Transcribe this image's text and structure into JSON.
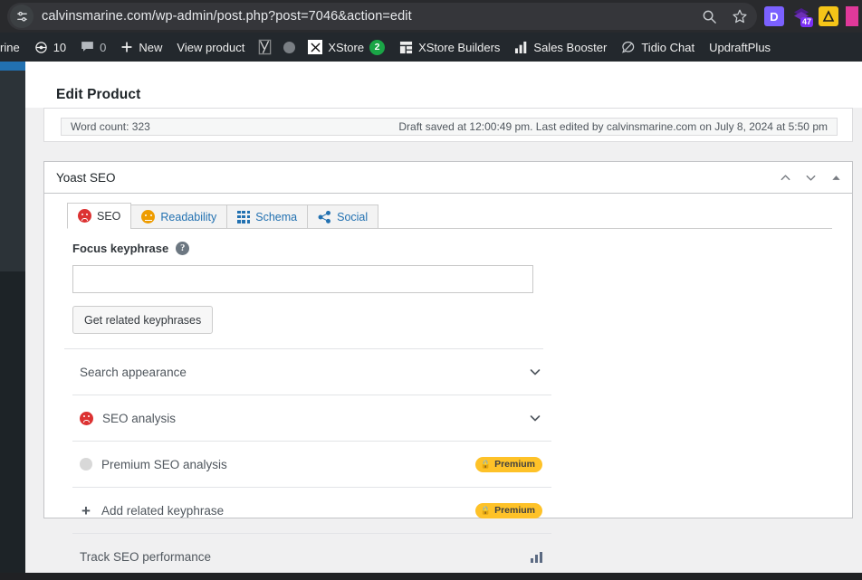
{
  "browser": {
    "site_info_icon": "tune-icon",
    "url": "calvinsmarine.com/wp-admin/post.php?post=7046&action=edit",
    "actions": [
      {
        "name": "search-icon",
        "glyph": "search"
      },
      {
        "name": "bookmark-star-icon",
        "glyph": "star"
      }
    ],
    "extensions": [
      {
        "name": "extension-icon-d",
        "label": "D",
        "bg": "#7b61ff",
        "fg": "#ffffff",
        "badge": null
      },
      {
        "name": "extension-icon-purple-stack",
        "label": "",
        "bg": "#5b2d8e",
        "fg": "#ffffff",
        "badge": "47"
      },
      {
        "name": "extension-icon-yellow-a",
        "label": "A",
        "bg": "#f5c518",
        "fg": "#1d1d1d",
        "badge": null
      },
      {
        "name": "extension-icon-pink",
        "label": "",
        "bg": "#e0399a",
        "fg": "#ffffff",
        "badge": null
      }
    ]
  },
  "adminbar": {
    "items": [
      {
        "name": "site-name",
        "label": "rine",
        "icon": null,
        "num": null,
        "count": null
      },
      {
        "name": "updates",
        "label": "",
        "icon": "updates-icon",
        "num": "10",
        "count": null
      },
      {
        "name": "comments",
        "label": "",
        "icon": "comment-icon",
        "num": "0",
        "count": null
      },
      {
        "name": "new-content",
        "label": "New",
        "icon": "plus-icon",
        "num": null,
        "count": null
      },
      {
        "name": "view-product",
        "label": "View product",
        "icon": null,
        "num": null,
        "count": null
      },
      {
        "name": "yoast-seo",
        "label": "",
        "icon": "yoast-y-icon",
        "num": null,
        "count": null
      },
      {
        "name": "notification-dot",
        "label": "",
        "icon": "grey-circle-icon",
        "num": null,
        "count": null
      },
      {
        "name": "xstore",
        "label": "XStore",
        "icon": "xstore-icon",
        "num": null,
        "count": "2"
      },
      {
        "name": "xstore-builders",
        "label": "XStore Builders",
        "icon": "builders-grid-icon",
        "num": null,
        "count": null
      },
      {
        "name": "sales-booster",
        "label": "Sales Booster",
        "icon": "bar-chart-icon",
        "num": null,
        "count": null
      },
      {
        "name": "tidio-chat",
        "label": "Tidio Chat",
        "icon": "chat-bubble-icon",
        "num": null,
        "count": null
      },
      {
        "name": "updraftplus",
        "label": "UpdraftPlus",
        "icon": null,
        "num": null,
        "count": null
      }
    ]
  },
  "page": {
    "title": "Edit Product",
    "word_count": "Word count: 323",
    "draft_saved": "Draft saved at 12:00:49 pm. Last edited by calvinsmarine.com on July 8, 2024 at 5:50 pm"
  },
  "yoast": {
    "panel_title": "Yoast SEO",
    "header_actions": [
      {
        "name": "move-up-button",
        "glyph": "chevron-up-icon"
      },
      {
        "name": "move-down-button",
        "glyph": "chevron-down-icon"
      },
      {
        "name": "toggle-panel-button",
        "glyph": "triangle-up-icon"
      }
    ],
    "tabs": [
      {
        "name": "tab-seo",
        "label": "SEO",
        "icon": "face-bad-icon",
        "active": true
      },
      {
        "name": "tab-readability",
        "label": "Readability",
        "icon": "face-ok-icon",
        "active": false
      },
      {
        "name": "tab-schema",
        "label": "Schema",
        "icon": "grid-icon",
        "active": false
      },
      {
        "name": "tab-social",
        "label": "Social",
        "icon": "share-icon",
        "active": false
      }
    ],
    "keyphrase": {
      "label": "Focus keyphrase",
      "help_glyph": "?",
      "value": "",
      "placeholder": "",
      "button_label": "Get related keyphrases"
    },
    "rows": [
      {
        "name": "row-search-appearance",
        "label": "Search appearance",
        "left_icon": null,
        "right": "chevron",
        "right_glyph": "chevron-down-icon",
        "badge": null
      },
      {
        "name": "row-seo-analysis",
        "label": "SEO analysis",
        "left_icon": "face-bad-icon",
        "right": "chevron",
        "right_glyph": "chevron-down-icon",
        "badge": null
      },
      {
        "name": "row-premium-seo-analysis",
        "label": "Premium SEO analysis",
        "left_icon": "grey-dot-icon",
        "right": "badge",
        "right_glyph": null,
        "badge": "Premium"
      },
      {
        "name": "row-add-related-keyphrase",
        "label": "Add related keyphrase",
        "left_icon": "plus-icon",
        "right": "badge",
        "right_glyph": null,
        "badge": "Premium"
      },
      {
        "name": "row-track-seo-performance",
        "label": "Track SEO performance",
        "left_icon": null,
        "right": "bars",
        "right_glyph": "bar-chart-icon",
        "badge": null
      }
    ]
  },
  "colors": {
    "wp_blue": "#2271b1",
    "yoast_red": "#dc3232",
    "yoast_orange": "#ee9c00",
    "premium_yellow": "#fec228",
    "adminbar_bg": "#23282d",
    "chrome_bg": "#292a2d"
  }
}
